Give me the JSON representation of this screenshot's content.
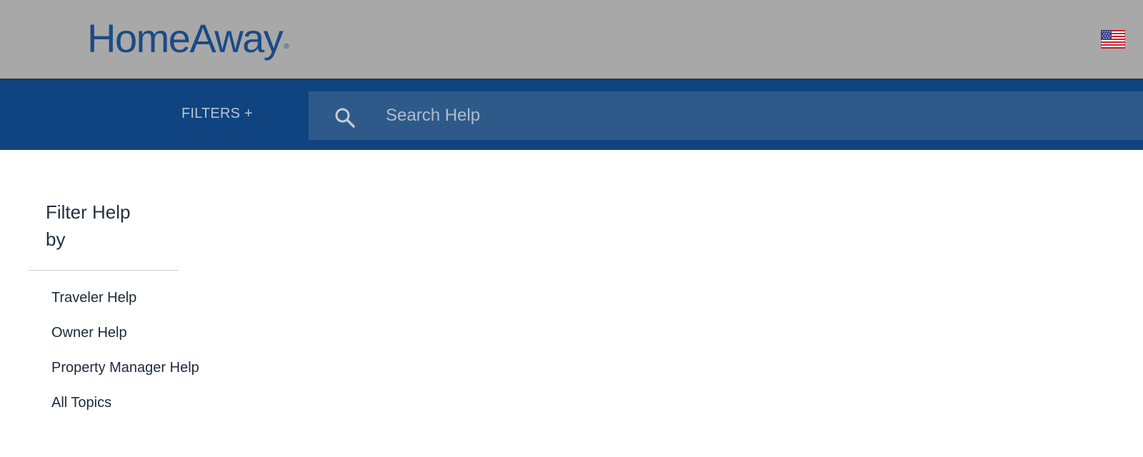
{
  "header": {
    "logo_text": "HomeAway",
    "logo_reg": "®",
    "flag_icon": "us-flag-icon"
  },
  "nav": {
    "filters_label": "FILTERS +",
    "search": {
      "placeholder": "Search Help",
      "value": "",
      "icon": "search-icon"
    }
  },
  "filter_panel": {
    "title": "Filter Help by",
    "items": [
      {
        "label": "Traveler Help"
      },
      {
        "label": "Owner Help"
      },
      {
        "label": "Property Manager Help"
      },
      {
        "label": "All Topics"
      }
    ]
  },
  "colors": {
    "topbar": "#a8a8a8",
    "navbar": "#0f4480",
    "search_box": "#2e5a8a",
    "logo": "#1b4a86"
  }
}
